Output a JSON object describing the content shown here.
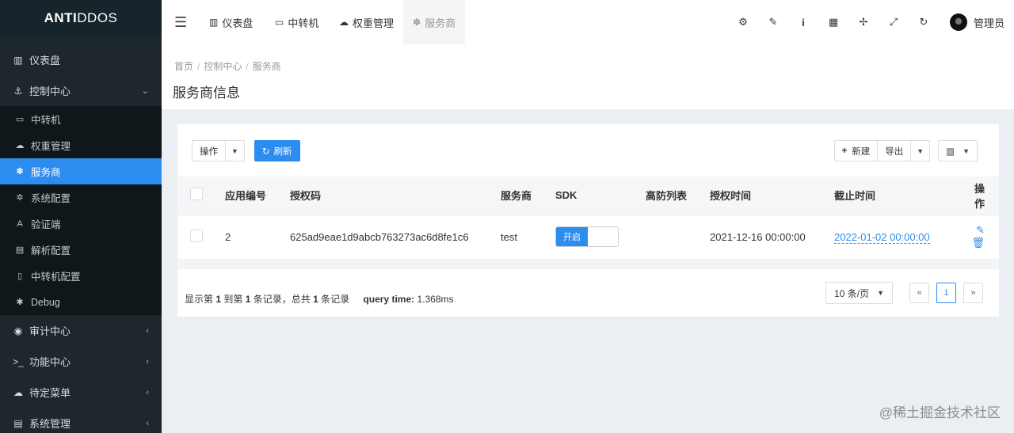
{
  "app": {
    "logo_bold": "ANTI",
    "logo_rest": "DDOS"
  },
  "sidebar": {
    "items": [
      {
        "label": "仪表盘",
        "icon": "bar-chart-icon"
      },
      {
        "label": "控制中心",
        "icon": "anchor-icon"
      }
    ],
    "sub_items": [
      {
        "label": "中转机",
        "icon": "desktop-icon"
      },
      {
        "label": "权重管理",
        "icon": "cloud-icon"
      },
      {
        "label": "服务商",
        "icon": "paw-icon"
      },
      {
        "label": "系统配置",
        "icon": "gear-icon"
      },
      {
        "label": "验证端",
        "icon": "language-icon"
      },
      {
        "label": "解析配置",
        "icon": "list-icon"
      },
      {
        "label": "中转机配置",
        "icon": "file-icon"
      },
      {
        "label": "Debug",
        "icon": "bug-icon"
      }
    ],
    "bottom_items": [
      {
        "label": "审计中心",
        "icon": "eye-icon"
      },
      {
        "label": "功能中心",
        "icon": "terminal-icon"
      },
      {
        "label": "待定菜单",
        "icon": "cloud-icon"
      },
      {
        "label": "系统管理",
        "icon": "list-icon"
      }
    ]
  },
  "navbar": {
    "tabs": [
      {
        "label": "仪表盘",
        "icon": "bar-chart-icon"
      },
      {
        "label": "中转机",
        "icon": "desktop-icon"
      },
      {
        "label": "权重管理",
        "icon": "cloud-icon"
      },
      {
        "label": "服务商",
        "icon": "paw-icon"
      }
    ],
    "user": "管理员"
  },
  "page": {
    "breadcrumb": [
      "首页",
      "控制中心",
      "服务商"
    ],
    "title": "服务商信息"
  },
  "toolbar": {
    "ops_label": "操作",
    "refresh_label": "刷新",
    "new_label": "新建",
    "export_label": "导出"
  },
  "table": {
    "headers": [
      "应用编号",
      "授权码",
      "服务商",
      "SDK",
      "高防列表",
      "授权时间",
      "截止时间",
      "操作"
    ],
    "rows": [
      {
        "id": "2",
        "code": "625ad9eae1d9abcb763273ac6d8fe1c6",
        "provider": "test",
        "sdk": "开启",
        "high_defense": "",
        "auth_time": "2021-12-16 00:00:00",
        "expire_time": "2022-01-02 00:00:00"
      }
    ]
  },
  "pager": {
    "info_prefix": "显示第 ",
    "from": "1",
    "mid1": " 到第 ",
    "to": "1",
    "mid2": " 条记录，总共 ",
    "total": "1",
    "suffix": " 条记录",
    "query_label": "query time:",
    "query_value": " 1.368ms",
    "page_size": "10 条/页",
    "prev": "«",
    "current": "1",
    "next": "»"
  },
  "watermark": "@稀土掘金技术社区",
  "colors": {
    "primary": "#2d8cf0",
    "sidebar_bg": "#1e282c"
  }
}
